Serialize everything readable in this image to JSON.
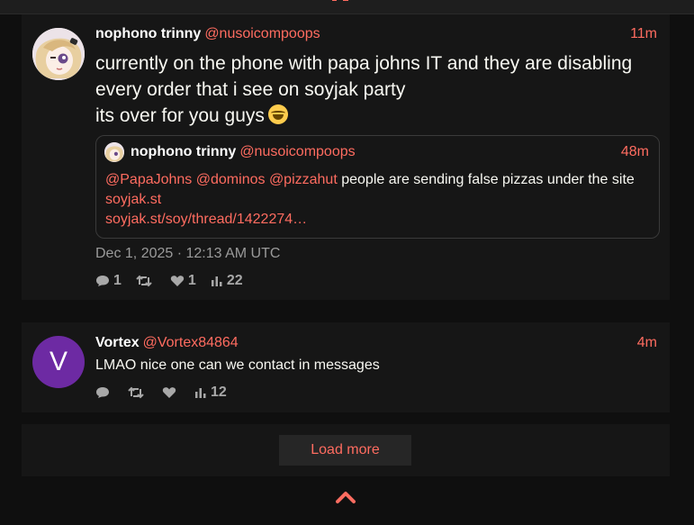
{
  "main_tweet": {
    "author_name": "nophono trinny",
    "author_handle": "@nusoicompoops",
    "time": "11m",
    "text_lines": [
      "currently on the phone with papa johns IT and they are disabling",
      "every order that i see on soyjak party",
      "its over for you guys"
    ],
    "emoji": "laughing-tears-emoji",
    "date": "Dec 1, 2025 · 12:13 AM UTC",
    "stats": {
      "replies": "1",
      "retweets": "",
      "likes": "1",
      "views": "22"
    }
  },
  "quoted_tweet": {
    "author_name": "nophono trinny",
    "author_handle": "@nusoicompoops",
    "time": "48m",
    "mention_1": "@PapaJohns",
    "mention_2": "@dominos",
    "mention_3": "@pizzahut",
    "text": "people are sending false pizzas under the site",
    "link_1": "soyjak.st",
    "link_2": "soyjak.st/soy/thread/1422274…"
  },
  "reply_tweet": {
    "avatar_letter": "V",
    "author_name": "Vortex",
    "author_handle": "@Vortex84864",
    "time": "4m",
    "text": "LMAO nice one can we contact in messages",
    "stats": {
      "replies": "",
      "retweets": "",
      "likes": "",
      "views": "12"
    }
  },
  "load_more_label": "Load more",
  "colors": {
    "accent": "#ff6c60",
    "background": "#0f0f0f",
    "card": "#161616",
    "avatar_purple": "#6d2aa3"
  }
}
